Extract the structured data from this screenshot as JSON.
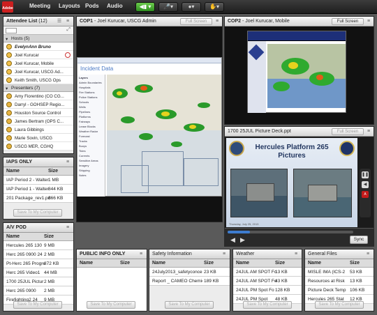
{
  "menubar": {
    "logo": "Adobe",
    "items": [
      "Meeting",
      "Layouts",
      "Pods",
      "Audio"
    ]
  },
  "attendee": {
    "title": "Attendee List",
    "count": "(12)",
    "hosts_label": "Hosts (5)",
    "hosts": [
      "EvelynAnn Bruno",
      "Joel Kurucar",
      "Joel Kurucar, Mobile",
      "Joel Kurucar, USCG Ad...",
      "Keith Smith, USCG Ops"
    ],
    "presenters_label": "Presenters (7)",
    "presenters": [
      "Amy Fiorentino (CO CG...",
      "Darryl - GOHSEP Regio...",
      "Houston Source Control",
      "James Bertram (OPS C...",
      "Laura Gibbings",
      "Marie Sovin, USCG",
      "USCG MER, CGHQ"
    ]
  },
  "iaps": {
    "title": "IAPS ONLY",
    "col_name": "Name",
    "col_size": "Size",
    "rows": [
      {
        "name": "IAP Period 2 - Walter",
        "size": "1 MB"
      },
      {
        "name": "IAP Period 1 - Walter",
        "size": "844 KB"
      },
      {
        "name": "201 Package_rev1.pd",
        "size": "866 KB"
      }
    ],
    "save": "Save To My Computer"
  },
  "avpod": {
    "title": "A/V POD",
    "col_name": "Name",
    "col_size": "Size",
    "rows": [
      {
        "name": "Hercules 265 130",
        "size": "9 MB"
      },
      {
        "name": "Herc 265 0900 24",
        "size": "2 MB"
      },
      {
        "name": "Pt-Herc 265 Progre",
        "size": "872 KB"
      },
      {
        "name": "Herc 265 Video1",
        "size": "44 MB"
      },
      {
        "name": "1700 25JUL Pictur",
        "size": "2 MB"
      },
      {
        "name": "Herc 265 0900",
        "size": "2 MB"
      },
      {
        "name": "Firefighting2 24",
        "size": "9 MB"
      }
    ],
    "save": "Save To My Computer"
  },
  "cop1": {
    "title": "COP1",
    "presenter": "Joel Kurucar, USCG Admin",
    "full_screen": "Full Screen",
    "page_heading": "Incident Data",
    "layers": [
      "Layers",
      "Admin Boundaries",
      "Hospitals",
      "Fire Stations",
      "Police Stations",
      "Schools",
      "Wells",
      "Pipelines",
      "Platforms",
      "Fairways",
      "Lease Blocks",
      "Weather Radar",
      "Forecast",
      "Tracks",
      "Buoys",
      "Tides",
      "Currents",
      "Sensitive Areas",
      "Imagery",
      "Shipping",
      "Notes"
    ]
  },
  "cop2": {
    "title": "COP2",
    "presenter": "Joel Kurucar, Mobile",
    "full_screen": "Full Screen"
  },
  "slides": {
    "title": "1700 25JUL Picture Deck.ppt",
    "full_screen": "Full Screen",
    "slide_title": "Hercules Platform 265",
    "slide_subtitle": "Pictures",
    "sync": "Sync",
    "footer": "Thursday, July 25, 2013"
  },
  "public": {
    "title": "PUBLIC INFO ONLY",
    "col_name": "Name",
    "col_size": "Size",
    "save": "Save To My Computer"
  },
  "safety": {
    "title": "Safety Information",
    "col_name": "Name",
    "col_size": "Size",
    "rows": [
      {
        "name": "24July2013_safetyconcern-r",
        "size": "23 KB"
      },
      {
        "name": "Report _ CAMEO Chemicals",
        "size": "189 KB"
      }
    ],
    "save": "Save To My Computer"
  },
  "weather": {
    "title": "Weather",
    "col_name": "Name",
    "col_size": "Size",
    "rows": [
      {
        "name": "24JUL AM SPOT Fo",
        "size": "13 KB"
      },
      {
        "name": "24JUL AM SPOT Fo",
        "size": "43 KB"
      },
      {
        "name": "24JUL PM Spot Fo",
        "size": "128 KB"
      },
      {
        "name": "24JUL PM Spot",
        "size": "48 KB"
      }
    ],
    "save": "Save To My Computer"
  },
  "general": {
    "title": "General Files",
    "col_name": "Name",
    "col_size": "Size",
    "rows": [
      {
        "name": "MISLE IMA (ICS-2",
        "size": "53 KB"
      },
      {
        "name": "Resources at Risk",
        "size": "13 KB"
      },
      {
        "name": "Picture Deck Temp",
        "size": "106 KB"
      },
      {
        "name": "Hercules 265 Stat",
        "size": "12 KB"
      }
    ],
    "save": "Save To My Computer"
  }
}
